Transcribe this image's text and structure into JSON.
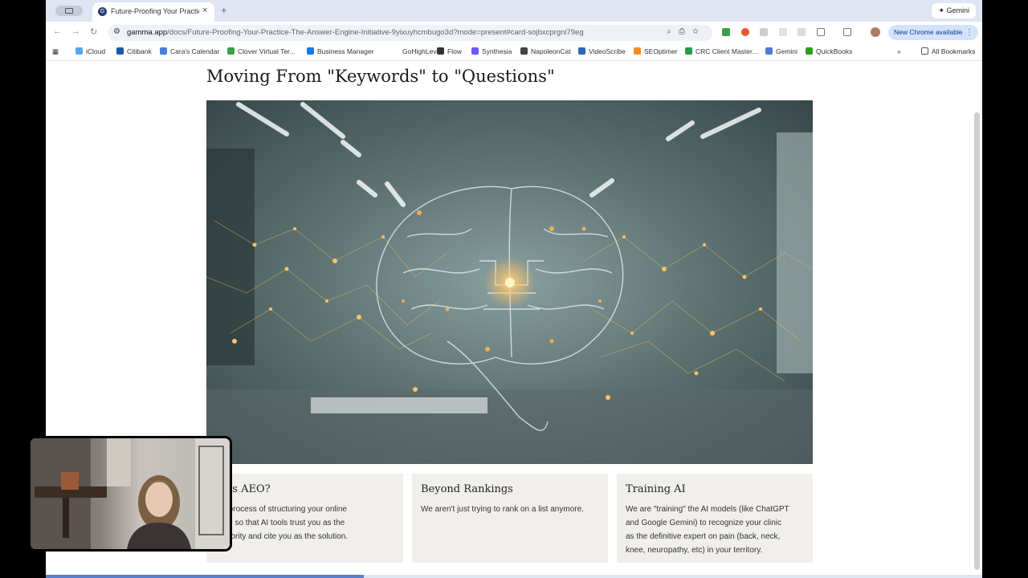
{
  "browser": {
    "tab_title": "Future-Proofing Your Practice",
    "new_tab": "+",
    "gemini_label": "Gemini",
    "url_domain": "gamma.app",
    "url_path": "/docs/Future-Proofing-Your-Practice-The-Answer-Engine-Initiative-9yixuyhcmbugo3d?mode=present#card-sojbxcprgni79eg",
    "update_label": "New Chrome available"
  },
  "bookmarks": [
    {
      "label": "iCloud",
      "color": "#5aa6e8"
    },
    {
      "label": "Citibank",
      "color": "#1a5aa8"
    },
    {
      "label": "Cara's Calendar",
      "color": "#4a7fd6"
    },
    {
      "label": "Clover Virtual Ter...",
      "color": "#3aa14a"
    },
    {
      "label": "Business Manager",
      "color": "#1877f2"
    },
    {
      "label": "GoHighLevel",
      "color": "#ffffff"
    },
    {
      "label": "Flow",
      "color": "#333333"
    },
    {
      "label": "Synthesia",
      "color": "#6b5cf0"
    },
    {
      "label": "NapoleonCat",
      "color": "#444444"
    },
    {
      "label": "VideoScribe",
      "color": "#2a6ab0"
    },
    {
      "label": "SEOptimer",
      "color": "#ff8a1f"
    },
    {
      "label": "CRC Client Master...",
      "color": "#1e9e4a"
    },
    {
      "label": "Gemini",
      "color": "#4a7fd6"
    },
    {
      "label": "QuickBooks",
      "color": "#2ca01c"
    }
  ],
  "bookmarks_overflow": "»",
  "all_bookmarks": "All Bookmarks",
  "slide": {
    "heading": "Moving From \"Keywords\" to \"Questions\"",
    "cards": [
      {
        "title": "at is AEO?",
        "lines": [
          "the process of structuring your online",
          "ence so that AI tools trust you as the",
          "authority and cite you as the solution."
        ]
      },
      {
        "title": "Beyond Rankings",
        "lines": [
          "We aren't just trying to rank on a list anymore."
        ]
      },
      {
        "title": "Training AI",
        "lines": [
          "We are \"training\" the AI models (like ChatGPT",
          "and Google Gemini) to recognize your clinic",
          "as the definitive expert on pain (back, neck,",
          "knee, neuropathy, etc) in your territory."
        ]
      }
    ]
  },
  "progress": 0.34
}
